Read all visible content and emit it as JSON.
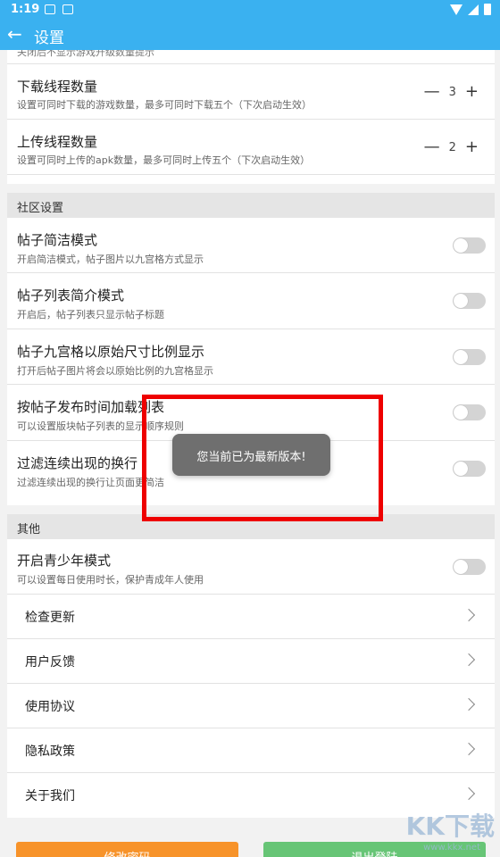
{
  "status_bar": {
    "time": "1:19"
  },
  "toolbar": {
    "title": "设置",
    "back_icon": "arrow-left-icon"
  },
  "clipped_text": "关闭后不显示游戏升级数量提示",
  "download_threads": {
    "title": "下载线程数量",
    "desc": "设置可同时下载的游戏数量，最多可同时下载五个（下次启动生效）",
    "minus": "—",
    "value": "3",
    "plus": "+"
  },
  "upload_threads": {
    "title": "上传线程数量",
    "desc": "设置可同时上传的apk数量，最多可同时上传五个（下次启动生效）",
    "minus": "—",
    "value": "2",
    "plus": "+"
  },
  "community": {
    "header": "社区设置",
    "items": [
      {
        "title": "帖子简洁模式",
        "desc": "开启简洁模式，帖子图片以九宫格方式显示",
        "on": false
      },
      {
        "title": "帖子列表简介模式",
        "desc": "开启后，帖子列表只显示帖子标题",
        "on": false
      },
      {
        "title": "帖子九宫格以原始尺寸比例显示",
        "desc": "打开后帖子图片将会以原始比例的九宫格显示",
        "on": false
      },
      {
        "title": "按帖子发布时间加载列表",
        "desc": "可以设置版块帖子列表的显示顺序规则",
        "on": false
      },
      {
        "title": "过滤连续出现的换行",
        "desc": "过滤连续出现的换行让页面更简洁",
        "on": false
      }
    ]
  },
  "other": {
    "header": "其他",
    "teen_mode": {
      "title": "开启青少年模式",
      "desc": "可以设置每日使用时长，保护青成年人使用",
      "on": false
    },
    "links": [
      {
        "label": "检查更新"
      },
      {
        "label": "用户反馈"
      },
      {
        "label": "使用协议"
      },
      {
        "label": "隐私政策"
      },
      {
        "label": "关于我们"
      }
    ]
  },
  "bottom_buttons": {
    "left": "修改密码",
    "right": "退出登陆"
  },
  "toast": {
    "message": "您当前已为最新版本!"
  },
  "watermark": {
    "text": "KK下载",
    "url": "www.kkx.net"
  },
  "colors": {
    "primary": "#3ab1f0",
    "toggle_off": "#d4d4d4",
    "highlight": "#ee0000",
    "left_button": "#f7932a",
    "right_button": "#67c576"
  }
}
